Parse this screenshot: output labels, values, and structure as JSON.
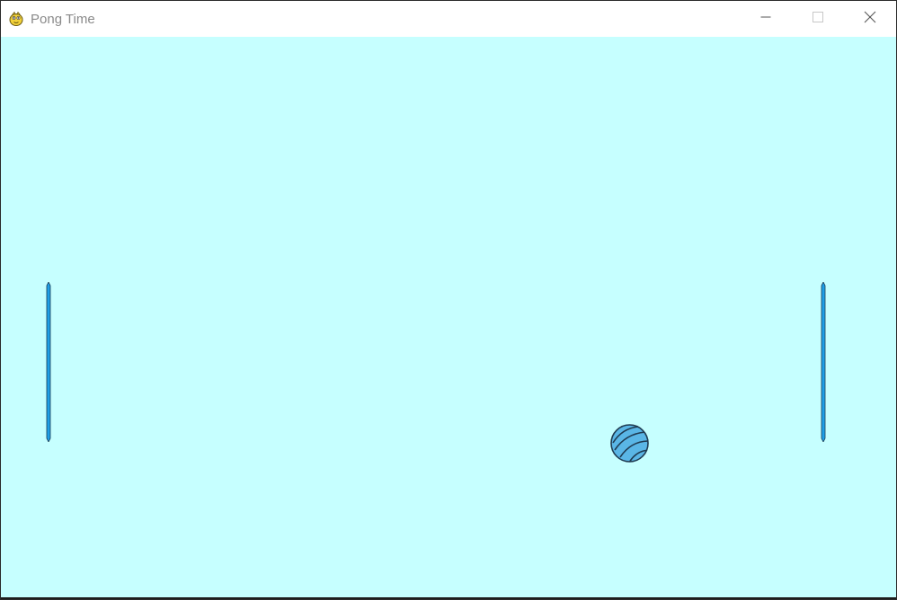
{
  "window": {
    "title": "Pong Time",
    "app_icon": "pygame-snake-icon",
    "controls": {
      "minimize_icon": "minimize-icon",
      "maximize_icon": "maximize-icon",
      "close_icon": "close-icon"
    }
  },
  "game": {
    "background_color": "#c6ffff",
    "left_paddle": {
      "color": "#1e9ee6"
    },
    "right_paddle": {
      "color": "#1e9ee6"
    },
    "ball": {
      "color": "#5ab6e6",
      "stripe_color": "#1f3b52",
      "icon": "striped-ball-icon"
    }
  }
}
